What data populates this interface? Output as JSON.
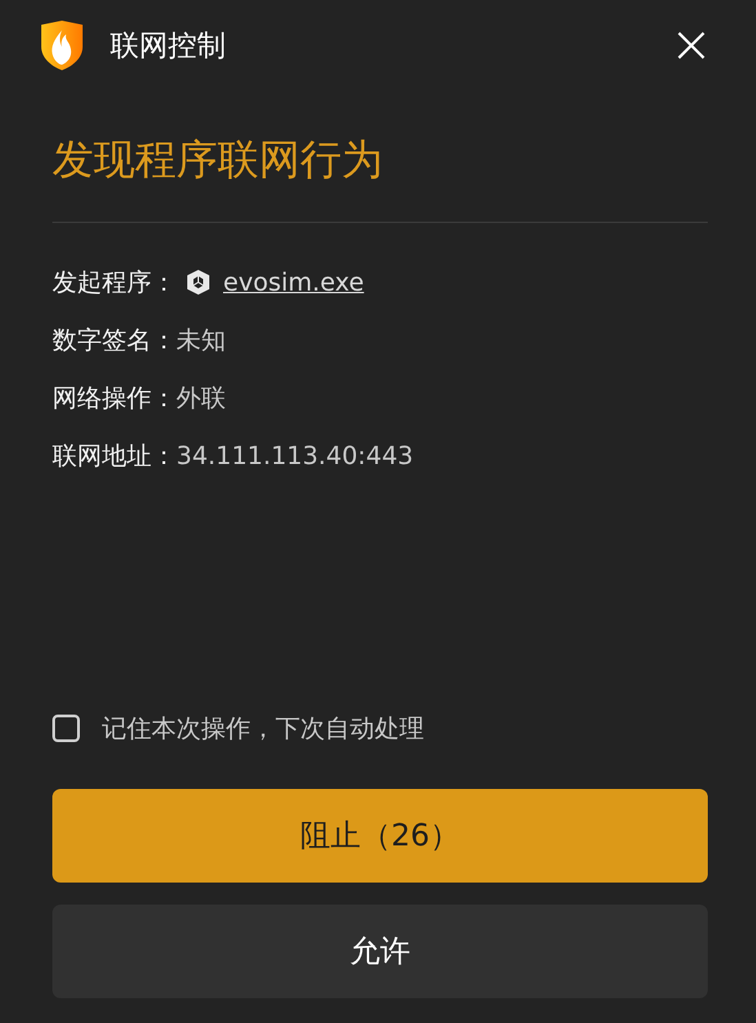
{
  "window": {
    "title": "联网控制"
  },
  "heading": "发现程序联网行为",
  "details": [
    {
      "label": "发起程序：",
      "value": "evosim.exe",
      "kind": "link"
    },
    {
      "label": "数字签名：",
      "value": "未知",
      "kind": "text"
    },
    {
      "label": "网络操作：",
      "value": "外联",
      "kind": "text"
    },
    {
      "label": "联网地址：",
      "value": "34.111.113.40:443",
      "kind": "text"
    }
  ],
  "remember": {
    "label": "记住本次操作，下次自动处理",
    "checked": false
  },
  "buttons": [
    {
      "label": "阻止（26）",
      "kind": "primary"
    },
    {
      "label": "允许",
      "kind": "secondary"
    }
  ]
}
